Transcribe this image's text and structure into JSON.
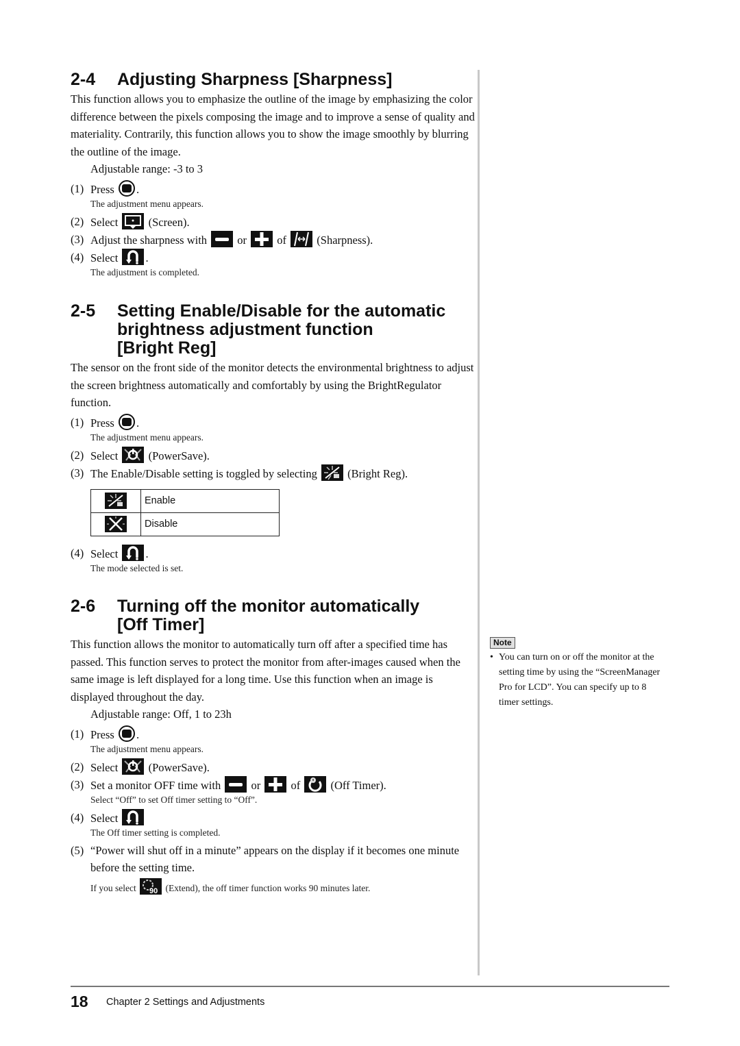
{
  "sections": [
    {
      "number": "2-4",
      "title": "Adjusting Sharpness [Sharpness]",
      "body": "This function allows you to emphasize the outline of the image by emphasizing the color difference between the pixels composing the image and to improve a sense of quality and materiality. Contrarily, this function allows you to show the image smoothly by blurring the outline of the image.",
      "range": "Adjustable range: -3 to 3",
      "steps": [
        {
          "n": "(1)",
          "pre": "Press",
          "post": ".",
          "icon": "menu-button-icon",
          "sub": "The adjustment menu appears."
        },
        {
          "n": "(2)",
          "pre": "Select",
          "post": "(Screen).",
          "icon": "screen-icon"
        },
        {
          "n": "(3)",
          "pre": "Adjust the sharpness with",
          "mid1": "or",
          "mid2": "of",
          "post": "(Sharpness).",
          "icons": [
            "minus-icon",
            "plus-icon",
            "sharpness-icon"
          ]
        },
        {
          "n": "(4)",
          "pre": "Select",
          "post": ".",
          "icon": "return-icon",
          "sub": "The adjustment is completed."
        }
      ]
    },
    {
      "number": "2-5",
      "title_lines": [
        "Setting Enable/Disable for the automatic",
        "brightness adjustment function",
        "[Bright Reg]"
      ],
      "body": "The sensor on the front side of the monitor detects the environmental brightness to adjust the screen brightness automatically and comfortably by using the BrightRegulator function.",
      "steps": [
        {
          "n": "(1)",
          "pre": "Press",
          "post": ".",
          "icon": "menu-button-icon",
          "sub": "The adjustment menu appears."
        },
        {
          "n": "(2)",
          "pre": "Select",
          "post": "(PowerSave).",
          "icon": "powersave-icon"
        },
        {
          "n": "(3)",
          "pre": "The Enable/Disable setting is toggled by selecting",
          "post": "(Bright Reg).",
          "icon": "bright-reg-icon"
        },
        {
          "n": "(4)",
          "pre": "Select",
          "post": ".",
          "icon": "return-icon",
          "sub": "The mode selected is set."
        }
      ],
      "options": [
        {
          "icon": "bright-reg-enable-icon",
          "label": "Enable"
        },
        {
          "icon": "bright-reg-disable-icon",
          "label": "Disable"
        }
      ]
    },
    {
      "number": "2-6",
      "title_lines": [
        "Turning off the monitor automatically",
        "[Off Timer]"
      ],
      "body": "This function allows the monitor to automatically turn off after a specified time has passed. This function serves to protect the monitor from after-images caused when the same image is left displayed for a long time. Use this function when an image is displayed throughout the day.",
      "range": "Adjustable range: Off, 1 to 23h",
      "steps": [
        {
          "n": "(1)",
          "pre": "Press",
          "post": ".",
          "icon": "menu-button-icon",
          "sub": "The adjustment menu appears."
        },
        {
          "n": "(2)",
          "pre": "Select",
          "post": "(PowerSave).",
          "icon": "powersave-icon"
        },
        {
          "n": "(3)",
          "pre": "Set a monitor OFF time with",
          "mid1": "or",
          "mid2": "of",
          "post": "(Off Timer).",
          "icons": [
            "minus-icon",
            "plus-icon",
            "off-timer-icon"
          ],
          "sub": "Select “Off” to set Off timer setting to “Off”."
        },
        {
          "n": "(4)",
          "pre": "Select",
          "post": "",
          "icon": "return-icon",
          "sub": "The Off timer setting is completed."
        },
        {
          "n": "(5)",
          "text": "“Power will shut off in a minute” appears on the display if it becomes one minute before the setting time.",
          "sub_pre": "If you select",
          "sub_post": "(Extend), the off timer function works 90 minutes later.",
          "sub_icon": "extend-icon"
        }
      ]
    }
  ],
  "note": {
    "tag": "Note",
    "bullet": "•",
    "text": "You can turn on or off the monitor at the setting time by using the “ScreenManager Pro for LCD”. You can specify up to 8 timer settings."
  },
  "footer": {
    "page_number": "18",
    "chapter": "Chapter 2  Settings and Adjustments"
  }
}
